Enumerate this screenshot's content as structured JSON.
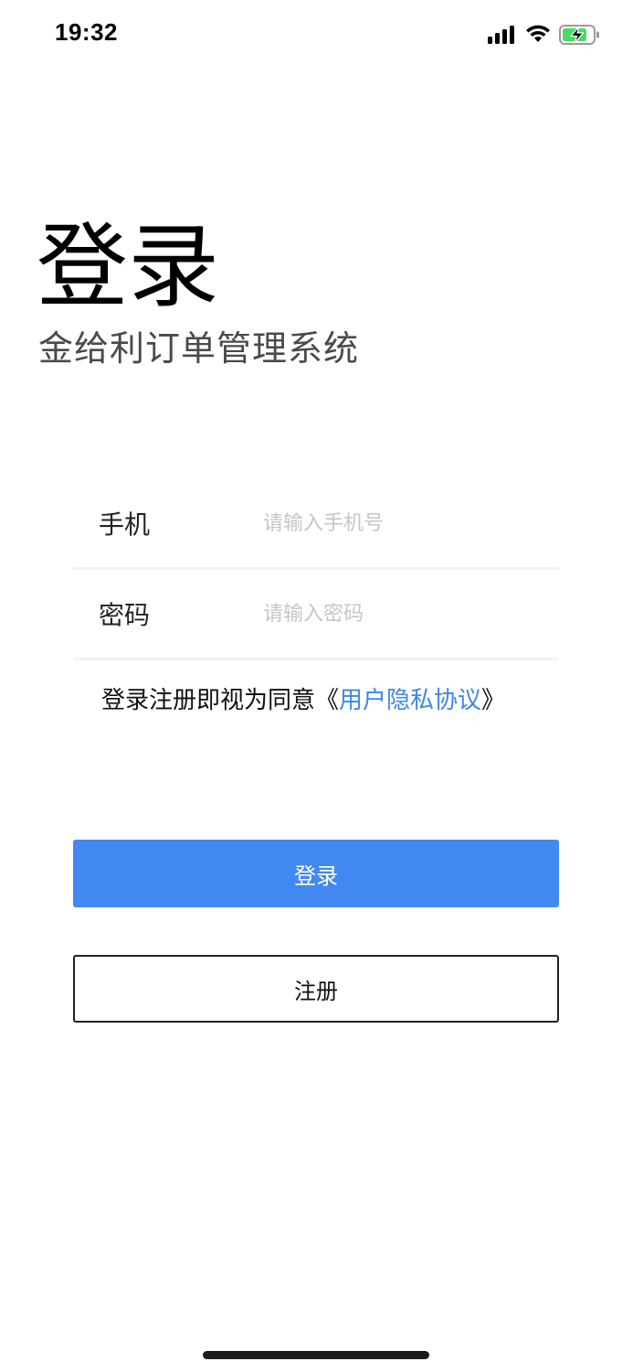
{
  "status_bar": {
    "time": "19:32",
    "icons": [
      "signal-icon",
      "wifi-icon",
      "battery-charging-icon"
    ]
  },
  "header": {
    "title": "登录",
    "subtitle": "金给利订单管理系统"
  },
  "form": {
    "phone": {
      "label": "手机",
      "placeholder": "请输入手机号",
      "value": ""
    },
    "password": {
      "label": "密码",
      "placeholder": "请输入密码",
      "value": ""
    }
  },
  "agreement": {
    "prefix": "登录注册即视为同意《",
    "link_text": "用户隐私协议",
    "suffix": "》"
  },
  "buttons": {
    "login_label": "登录",
    "register_label": "注册"
  },
  "colors": {
    "primary": "#4288f1",
    "link": "#3f86e8",
    "battery_charge": "#4cd964"
  }
}
